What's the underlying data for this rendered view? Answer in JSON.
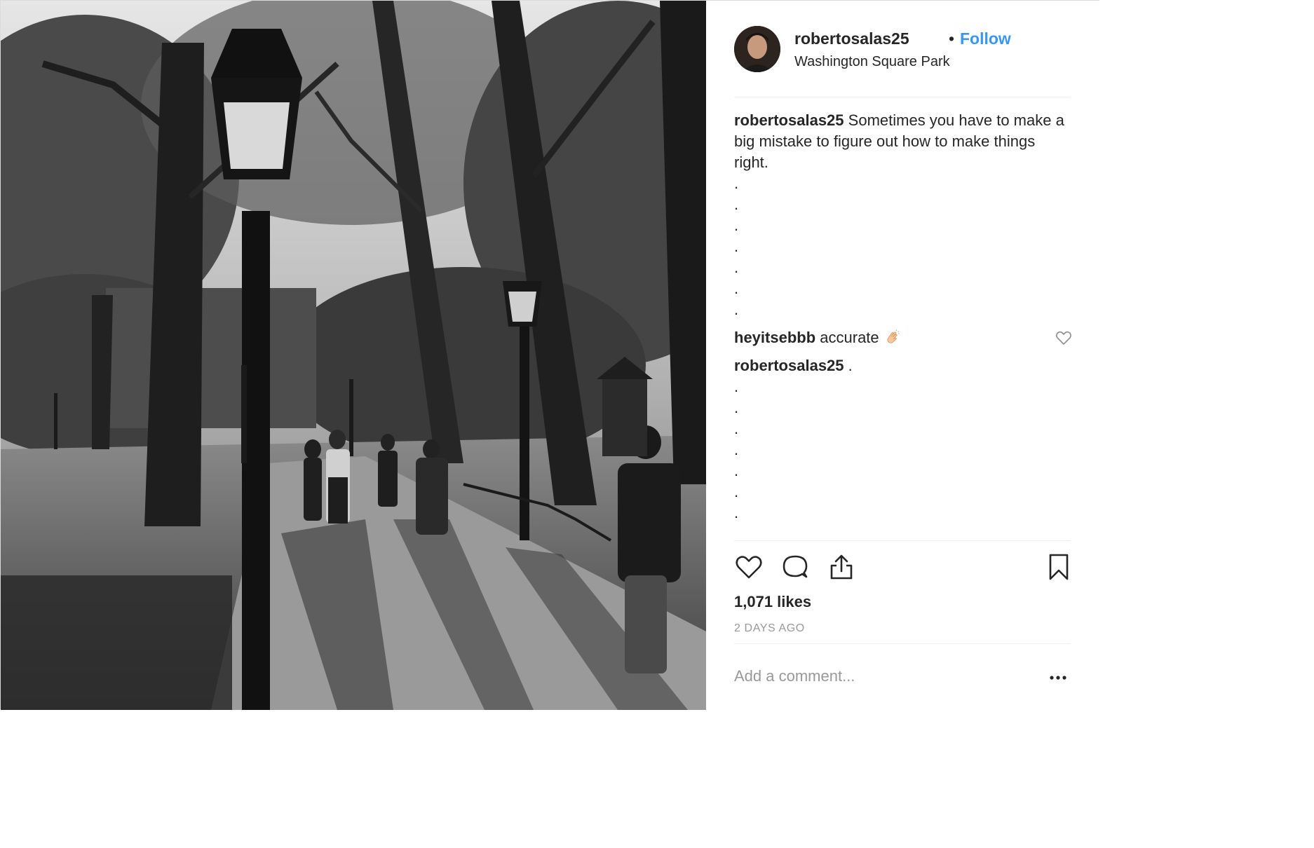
{
  "header": {
    "username": "robertosalas25",
    "separator": "•",
    "follow_label": "Follow",
    "location": "Washington Square Park"
  },
  "caption": {
    "username": "robertosalas25",
    "text": "Sometimes you have to make a big mistake to figure out how to make things right.",
    "trailing_dots": [
      ".",
      ".",
      ".",
      ".",
      ".",
      ".",
      "."
    ]
  },
  "comments": [
    {
      "username": "heyitsebbb",
      "text": "accurate",
      "emoji": "clapping-hands"
    },
    {
      "username": "robertosalas25",
      "text": ".",
      "trailing_dots": [
        ".",
        ".",
        ".",
        ".",
        ".",
        ".",
        "."
      ]
    }
  ],
  "actions": {
    "icons": [
      "heart-icon",
      "comment-icon",
      "share-icon",
      "bookmark-icon"
    ]
  },
  "likes": "1,071 likes",
  "time_ago": "2 DAYS AGO",
  "add_comment": {
    "placeholder": "Add a comment..."
  },
  "more_options_label": "•••",
  "colors": {
    "link": "#3897f0",
    "text": "#262626",
    "muted": "#999999",
    "divider": "#efefef"
  }
}
